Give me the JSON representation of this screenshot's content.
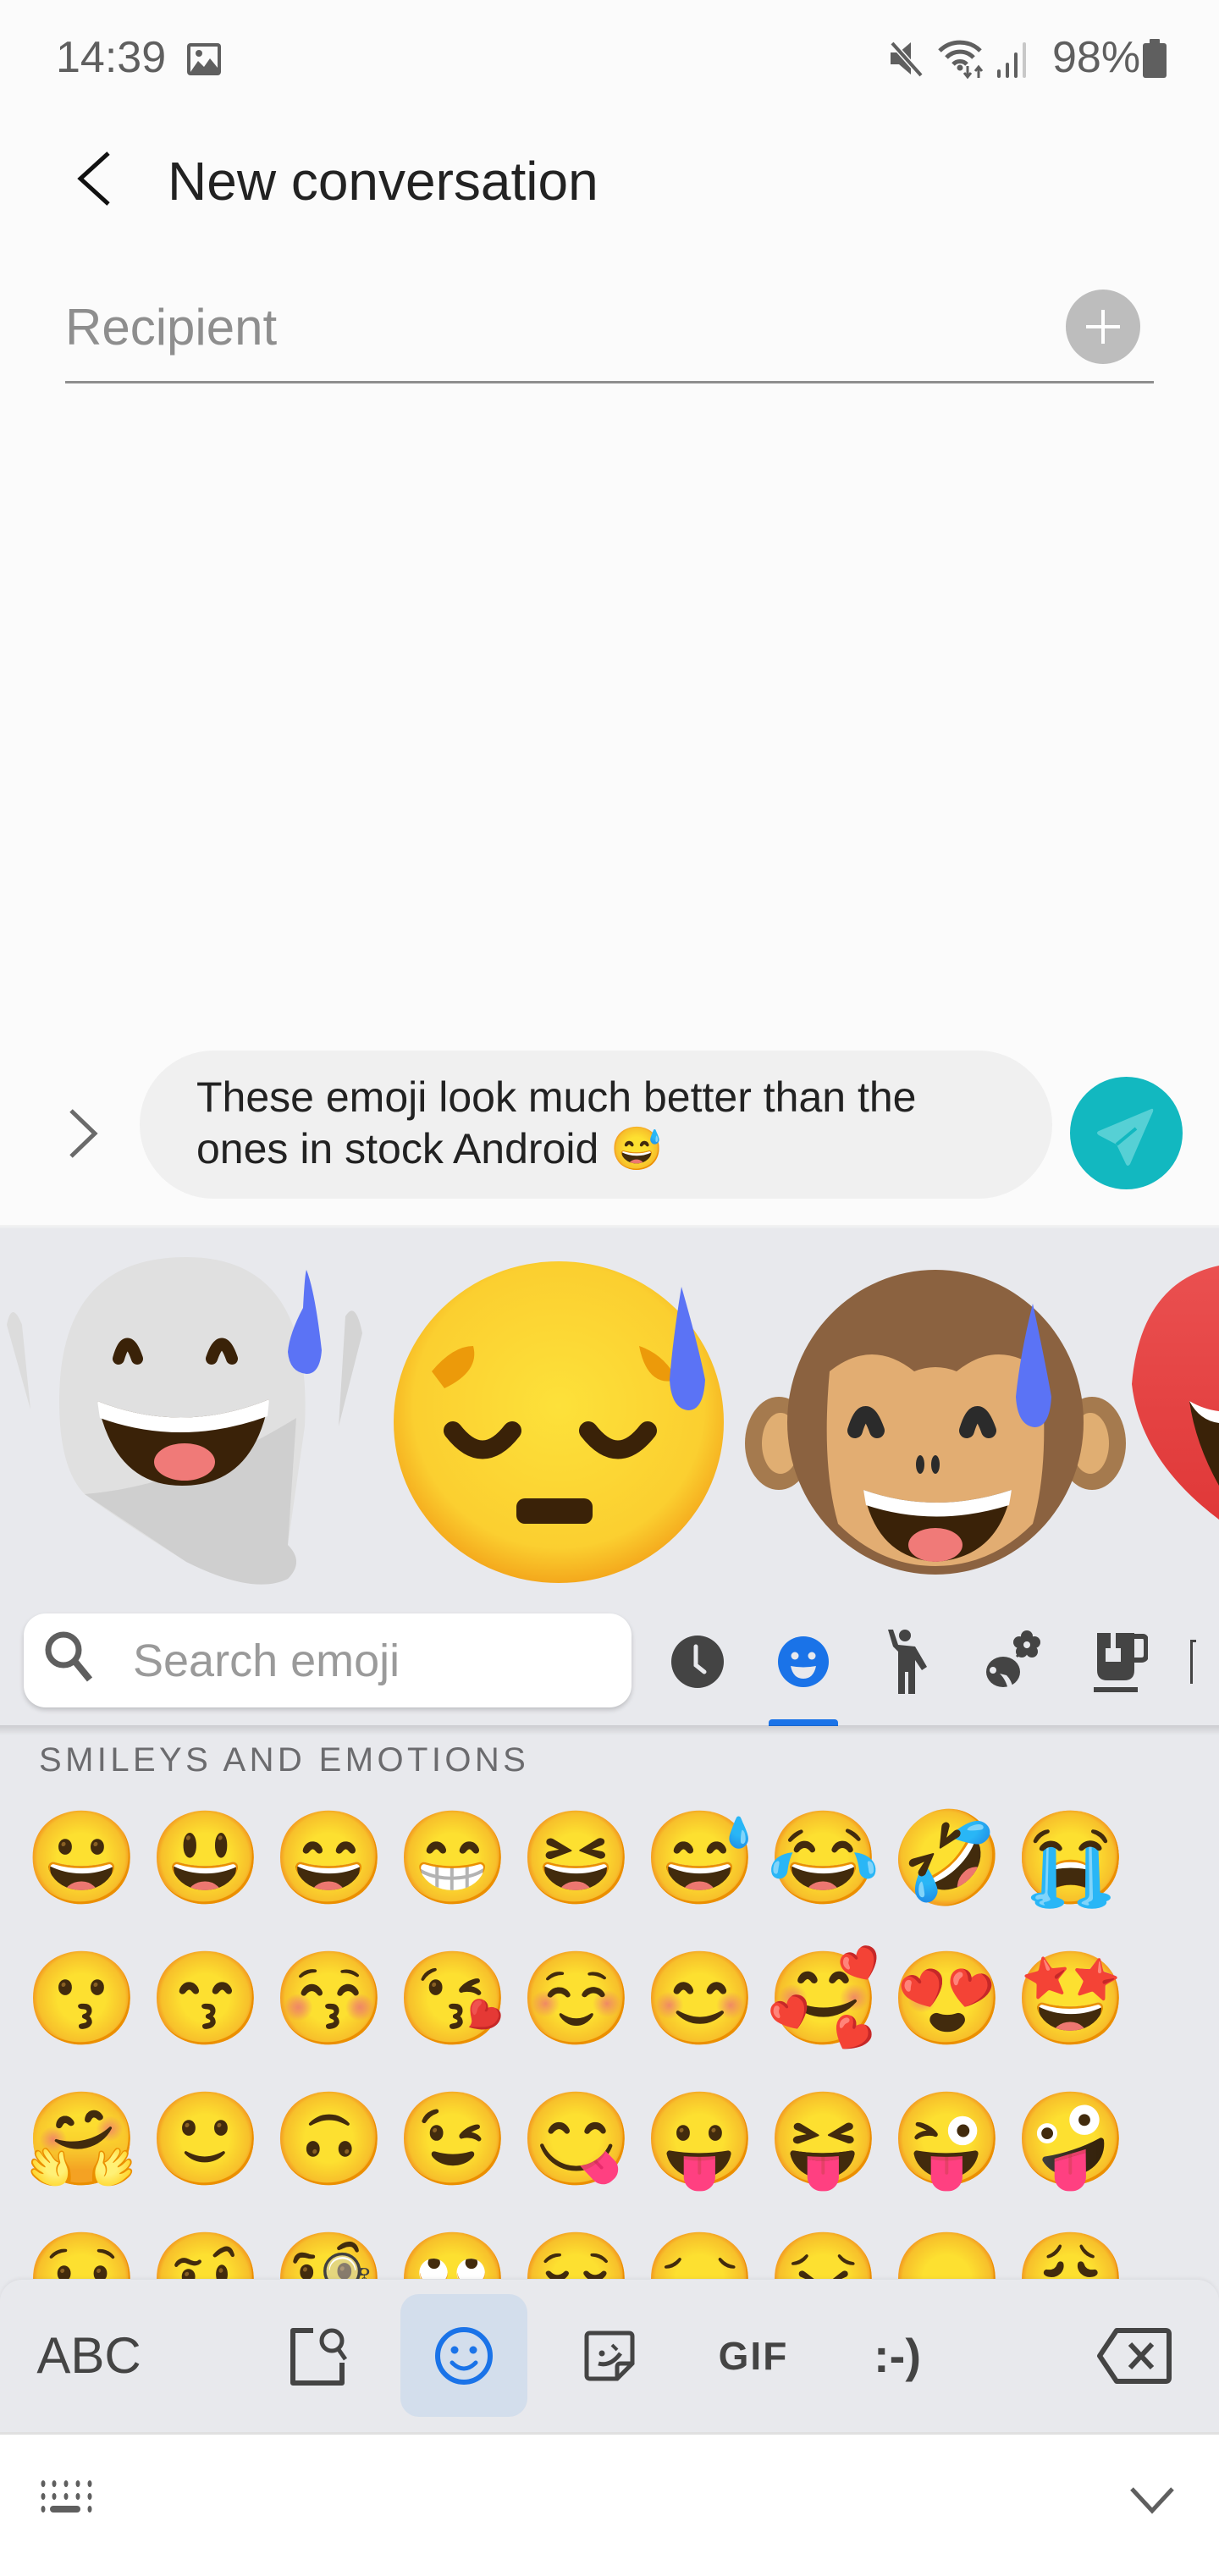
{
  "status_bar": {
    "time": "14:39",
    "battery_percent": "98%",
    "icons": [
      "gallery-icon",
      "mute-icon",
      "wifi-icon",
      "signal-icon",
      "battery-icon"
    ]
  },
  "header": {
    "back_icon": "back-chevron-icon",
    "title": "New conversation"
  },
  "recipient": {
    "placeholder": "Recipient",
    "value": "",
    "add_icon": "plus-icon"
  },
  "composer": {
    "expand_icon": "chevron-right-icon",
    "message_text": "These emoji look much better than the ones in stock Android 😅",
    "send_icon": "send-icon",
    "accent_color": "#12b8c0"
  },
  "emoji_keyboard": {
    "suggestions": [
      {
        "name": "ghost sweat",
        "glyph": "👻"
      },
      {
        "name": "pensive sweat",
        "glyph": "😓"
      },
      {
        "name": "monkey sweat",
        "glyph": "🐵"
      },
      {
        "name": "heart",
        "glyph": "❤️"
      }
    ],
    "search": {
      "placeholder": "Search emoji",
      "value": ""
    },
    "category_tabs": [
      {
        "name": "recent",
        "icon": "clock-icon",
        "active": false
      },
      {
        "name": "smileys",
        "icon": "smiley-icon",
        "active": true
      },
      {
        "name": "people",
        "icon": "person-icon",
        "active": false
      },
      {
        "name": "animals-nature",
        "icon": "animals-icon",
        "active": false
      },
      {
        "name": "food-drink",
        "icon": "cup-icon",
        "active": false
      },
      {
        "name": "travel",
        "icon": "travel-icon",
        "active": false
      }
    ],
    "active_color": "#1a73e8",
    "section_label": "SMILEYS AND EMOTIONS",
    "rows": [
      [
        "😀",
        "😃",
        "😄",
        "😁",
        "😆",
        "😅",
        "😂",
        "🤣",
        "😭"
      ],
      [
        "😗",
        "😙",
        "😚",
        "😘",
        "☺️",
        "😊",
        "🥰",
        "😍",
        "🤩"
      ],
      [
        "🤗",
        "🙂",
        "🙃",
        "😉",
        "😋",
        "😛",
        "😝",
        "😜",
        "🤪"
      ],
      [
        "😯",
        "🤨",
        "🧐",
        "🙄",
        "😌",
        "😔",
        "😣",
        "😞",
        "😩"
      ]
    ],
    "toolbar": {
      "abc_label": "ABC",
      "gif_label": "GIF",
      "emoticon_label": ":-)",
      "icons": [
        "bitmoji-search-icon",
        "emoji-icon",
        "sticker-icon",
        "backspace-icon"
      ]
    }
  },
  "nav_bar": {
    "keyboard_icon": "keyboard-icon",
    "hide_icon": "chevron-down-icon"
  }
}
